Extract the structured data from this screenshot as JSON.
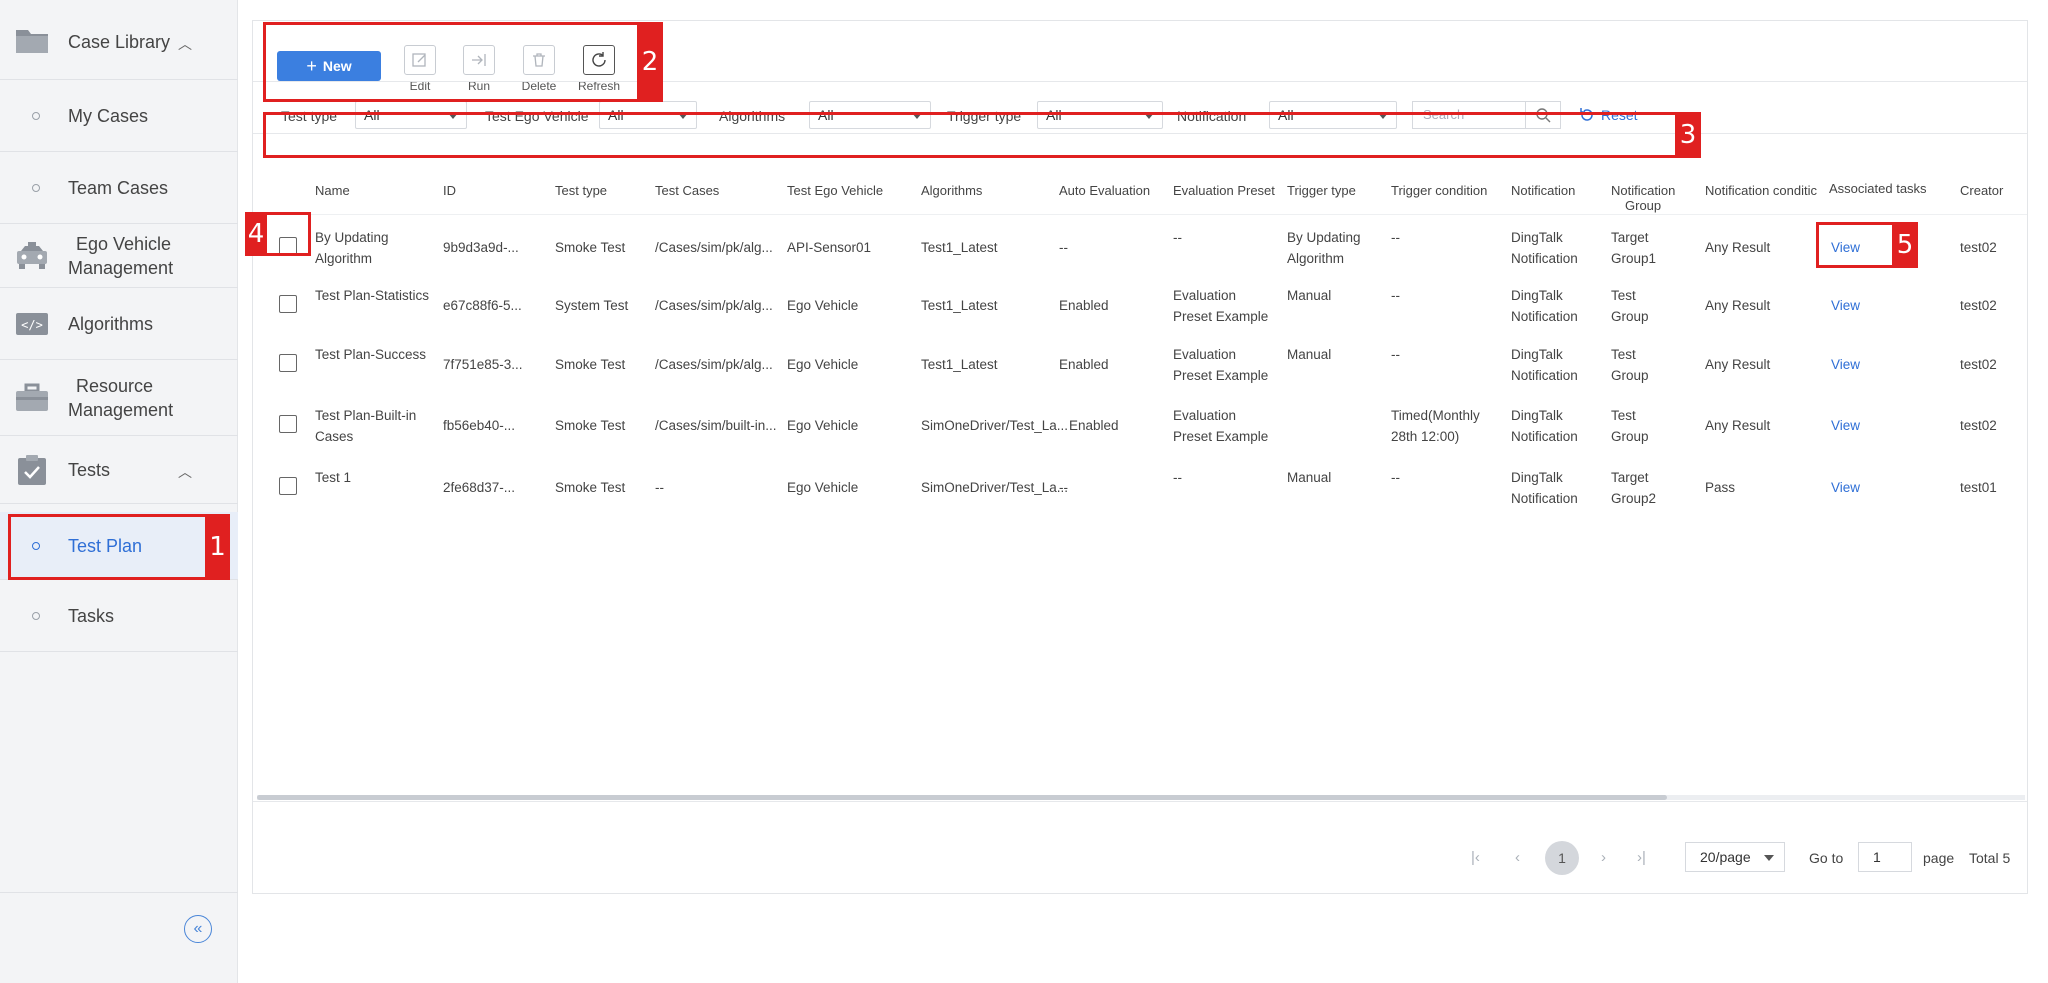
{
  "sidebar": {
    "case_library": "Case Library",
    "my_cases": "My Cases",
    "team_cases": "Team Cases",
    "ego_line1": "Ego Vehicle",
    "ego_line2": "Management",
    "algorithms": "Algorithms",
    "resource_line1": "Resource",
    "resource_line2": "Management",
    "tests": "Tests",
    "test_plan": "Test Plan",
    "tasks": "Tasks",
    "collapse_glyph": "«"
  },
  "toolbar": {
    "new_label": "New",
    "edit_label": "Edit",
    "run_label": "Run",
    "delete_label": "Delete",
    "refresh_label": "Refresh"
  },
  "filters": {
    "test_type_label": "Test type",
    "test_type_value": "All",
    "ego_label": "Test Ego Vehicle",
    "ego_value": "All",
    "algorithms_label": "Algorithms",
    "algorithms_value": "All",
    "trigger_label": "Trigger type",
    "trigger_value": "All",
    "notification_label": "Notification",
    "notification_value": "All",
    "search_placeholder": "Search",
    "reset_label": "Reset"
  },
  "table": {
    "headers": {
      "name": "Name",
      "id": "ID",
      "test_type": "Test type",
      "test_cases": "Test Cases",
      "ego": "Test Ego Vehicle",
      "algorithms": "Algorithms",
      "auto_eval": "Auto Evaluation",
      "eval_preset": "Evaluation Preset",
      "trigger_type": "Trigger type",
      "trigger_cond": "Trigger condition",
      "notification": "Notification",
      "notif_group_1": "Notification",
      "notif_group_2": "Group",
      "notif_cond": "Notification conditic",
      "assoc": "Associated tasks",
      "creator": "Creator"
    },
    "rows": [
      {
        "name_1": "By Updating",
        "name_2": "Algorithm",
        "id": "9b9d3a9d-...",
        "test_type": "Smoke Test",
        "test_cases": "/Cases/sim/pk/alg...",
        "ego": "API-Sensor01",
        "algorithms": "Test1_Latest",
        "auto_eval": "--",
        "eval_1": "--",
        "eval_2": "",
        "trigger_1": "By Updating",
        "trigger_2": "Algorithm",
        "cond_1": "--",
        "cond_2": "",
        "notif_1": "DingTalk",
        "notif_2": "Notification",
        "group_1": "Target",
        "group_2": "Group1",
        "notif_cond": "Any Result",
        "assoc": "View",
        "creator": "test02"
      },
      {
        "name_1": "Test Plan-Statistics",
        "name_2": "",
        "id": "e67c88f6-5...",
        "test_type": "System Test",
        "test_cases": "/Cases/sim/pk/alg...",
        "ego": "Ego Vehicle",
        "algorithms": "Test1_Latest",
        "auto_eval": "Enabled",
        "eval_1": "Evaluation",
        "eval_2": "Preset Example",
        "trigger_1": "Manual",
        "trigger_2": "",
        "cond_1": "--",
        "cond_2": "",
        "notif_1": "DingTalk",
        "notif_2": "Notification",
        "group_1": "Test",
        "group_2": "Group",
        "notif_cond": "Any Result",
        "assoc": "View",
        "creator": "test02"
      },
      {
        "name_1": "Test Plan-Success",
        "name_2": "",
        "id": "7f751e85-3...",
        "test_type": "Smoke Test",
        "test_cases": "/Cases/sim/pk/alg...",
        "ego": "Ego Vehicle",
        "algorithms": "Test1_Latest",
        "auto_eval": "Enabled",
        "eval_1": "Evaluation",
        "eval_2": "Preset Example",
        "trigger_1": "Manual",
        "trigger_2": "",
        "cond_1": "--",
        "cond_2": "",
        "notif_1": "DingTalk",
        "notif_2": "Notification",
        "group_1": "Test",
        "group_2": "Group",
        "notif_cond": "Any Result",
        "assoc": "View",
        "creator": "test02"
      },
      {
        "name_1": "Test Plan-Built-in",
        "name_2": "Cases",
        "id": "fb56eb40-...",
        "test_type": "Smoke Test",
        "test_cases": "/Cases/sim/built-in...",
        "ego": "Ego Vehicle",
        "algorithms": "SimOneDriver/Test_La...",
        "auto_eval": "Enabled",
        "eval_1": "Evaluation",
        "eval_2": "Preset Example",
        "trigger_1": "",
        "trigger_2": "",
        "cond_1": "Timed(Monthly",
        "cond_2": "28th 12:00)",
        "notif_1": "DingTalk",
        "notif_2": "Notification",
        "group_1": "Test",
        "group_2": "Group",
        "notif_cond": "Any Result",
        "assoc": "View",
        "creator": "test02"
      },
      {
        "name_1": "Test 1",
        "name_2": "",
        "id": "2fe68d37-...",
        "test_type": "Smoke Test",
        "test_cases": "--",
        "ego": "Ego Vehicle",
        "algorithms": "SimOneDriver/Test_La...",
        "auto_eval": "--",
        "eval_1": "--",
        "eval_2": "",
        "trigger_1": "Manual",
        "trigger_2": "",
        "cond_1": "--",
        "cond_2": "",
        "notif_1": "DingTalk",
        "notif_2": "Notification",
        "group_1": "Target",
        "group_2": "Group2",
        "notif_cond": "Pass",
        "assoc": "View",
        "creator": "test01"
      }
    ]
  },
  "pagination": {
    "first": "|‹",
    "prev": "‹",
    "current_page": "1",
    "next": "›",
    "last": "›|",
    "page_size": "20/page",
    "goto_label": "Go to",
    "goto_value": "1",
    "page_label": "page",
    "total": "Total 5"
  },
  "annotations": {
    "a1": "1",
    "a2": "2",
    "a3": "3",
    "a4": "4",
    "a5": "5"
  },
  "colors": {
    "accent": "#3b7fe0",
    "annotation": "#e02020",
    "link": "#2f6fd6"
  }
}
